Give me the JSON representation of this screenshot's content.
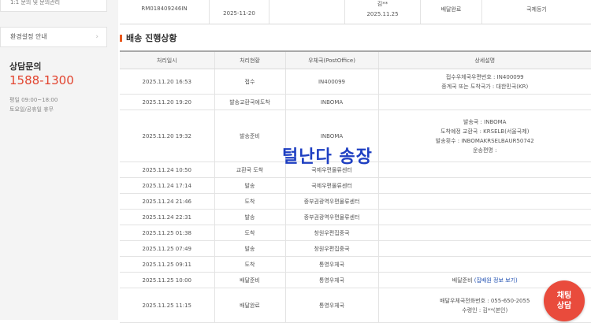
{
  "sidebar": {
    "top_item": "1:1 문의 및 문의관리",
    "setting_label": "환경설정 안내",
    "setting_chevron": "›",
    "cs_title": "상담문의",
    "cs_phone": "1588-1300",
    "cs_hours_1": "평일 09:00~18:00",
    "cs_hours_2": "토요일/공휴일 휴무"
  },
  "summary": {
    "tracking_no": "RM018409246IN",
    "date": "2025-11-20",
    "blank": "",
    "receiver": "김**",
    "delivered_date": "2025.11.25",
    "status": "배달완료",
    "type": "국제등기"
  },
  "section_title": "배송 진행상황",
  "table": {
    "headers": [
      "처리일시",
      "처리현황",
      "우체국(PostOffice)",
      "상세설명"
    ],
    "rows": [
      {
        "time": "2025.11.20 16:53",
        "status": "접수",
        "office": "IN400099",
        "detail": [
          "접수우체국우편번호 : IN400099",
          "종계국 또는 도착국가 : 대한민국(KR)"
        ]
      },
      {
        "time": "2025.11.20 19:20",
        "status": "발송교환국에도착",
        "office": "INBOMA",
        "detail": []
      },
      {
        "time": "2025.11.20 19:32",
        "status": "발송준비",
        "office": "INBOMA",
        "detail": [
          "발송국 : INBOMA",
          "도착예정 교환국 : KRSELB(서울국제)",
          "발송횟수 : INBOMAKRSELBAUR50742",
          "운송편명 :"
        ]
      },
      {
        "time": "2025.11.24 10:50",
        "status": "교환국 도착",
        "office": "국제우편물류센터",
        "detail": []
      },
      {
        "time": "2025.11.24 17:14",
        "status": "발송",
        "office": "국제우편물류센터",
        "detail": []
      },
      {
        "time": "2025.11.24 21:46",
        "status": "도착",
        "office": "중부권광역우편물류센터",
        "detail": []
      },
      {
        "time": "2025.11.24 22:31",
        "status": "발송",
        "office": "중부권광역우편물류센터",
        "detail": []
      },
      {
        "time": "2025.11.25 01:38",
        "status": "도착",
        "office": "창원우편집중국",
        "detail": []
      },
      {
        "time": "2025.11.25 07:49",
        "status": "발송",
        "office": "창원우편집중국",
        "detail": []
      },
      {
        "time": "2025.11.25 09:11",
        "status": "도착",
        "office": "통영우체국",
        "detail": []
      },
      {
        "time": "2025.11.25 10:00",
        "status": "배달준비",
        "office": "통영우체국",
        "detail_prefix": "배달준비",
        "detail_link": "(집배원 정보 보기)"
      },
      {
        "time": "2025.11.25 11:15",
        "status": "배달완료",
        "office": "통영우체국",
        "detail": [
          "배달우체국전화번호 : 055-650-2055",
          "수령인 : 김**(본인)"
        ]
      }
    ]
  },
  "stamp_text": "털난다 송장",
  "chat_button": {
    "line1": "채팅",
    "line2": "상담"
  },
  "colors": {
    "accent_orange": "#e8581e",
    "phone_red": "#e2442f",
    "chat_red": "#e94b3c",
    "stamp_blue": "#1e3fc2"
  }
}
